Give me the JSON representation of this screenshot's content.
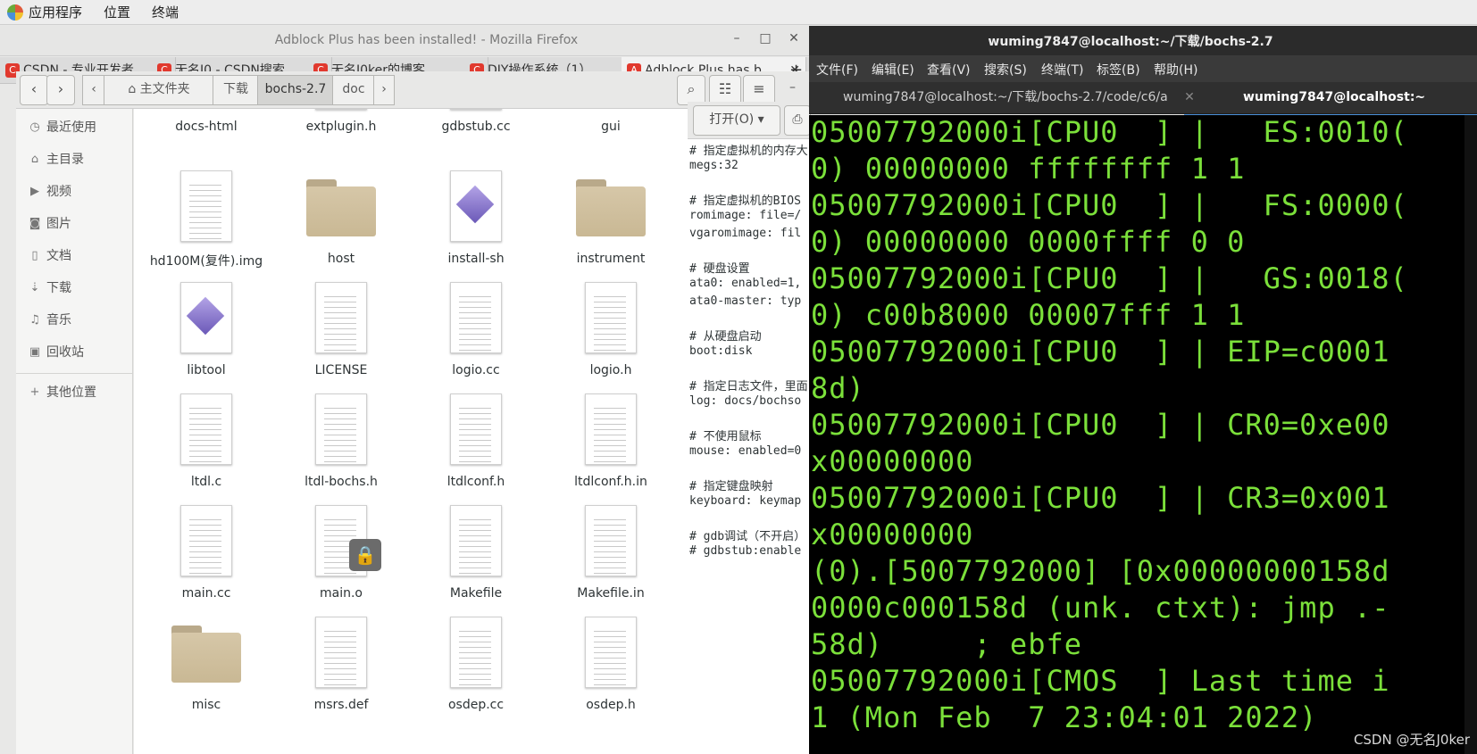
{
  "topbar": {
    "apps": "应用程序",
    "places": "位置",
    "terminal": "终端"
  },
  "firefox": {
    "title": "Adblock Plus has been installed! - Mozilla Firefox",
    "tabs": [
      {
        "label": "CSDN - 专业开发者"
      },
      {
        "label": "无名J0 - CSDN搜索"
      },
      {
        "label": "无名J0ker的博客"
      },
      {
        "label": "DIY操作系统（1）"
      },
      {
        "label": "Adblock Plus has b"
      }
    ]
  },
  "files": {
    "path": [
      "主文件夹",
      "下载",
      "bochs-2.7",
      "doc"
    ],
    "sidebar": [
      "最近使用",
      "主目录",
      "视频",
      "图片",
      "文档",
      "下载",
      "音乐",
      "回收站"
    ],
    "other_places": "其他位置",
    "items": [
      "docs-html",
      "extplugin.h",
      "gdbstub.cc",
      "gui",
      "hd100M(复件).img",
      "host",
      "install-sh",
      "instrument",
      "libtool",
      "LICENSE",
      "logio.cc",
      "logio.h",
      "ltdl.c",
      "ltdl-bochs.h",
      "ltdlconf.h",
      "ltdlconf.h.in",
      "main.cc",
      "main.o",
      "Makefile",
      "Makefile.in",
      "misc",
      "msrs.def",
      "osdep.cc",
      "osdep.h"
    ]
  },
  "gedit": {
    "open_button": "打开(O)",
    "lines": [
      "# 指定虚拟机的内存大",
      "megs:32",
      "",
      "# 指定虚拟机的BIOS",
      "romimage: file=/",
      "vgaromimage: fil",
      "",
      "# 硬盘设置",
      "ata0: enabled=1,",
      "ata0-master: typ",
      "",
      "# 从硬盘启动",
      "boot:disk",
      "",
      "# 指定日志文件，里面",
      "log: docs/bochso",
      "",
      "# 不使用鼠标",
      "mouse: enabled=0",
      "",
      "# 指定键盘映射",
      "keyboard: keymap",
      "",
      "# gdb调试（不开启）",
      "# gdbstub:enable"
    ]
  },
  "terminal": {
    "title": "wuming7847@localhost:~/下载/bochs-2.7",
    "menu": [
      "文件(F)",
      "编辑(E)",
      "查看(V)",
      "搜索(S)",
      "终端(T)",
      "标签(B)",
      "帮助(H)"
    ],
    "tabs": [
      "wuming7847@localhost:~/下载/bochs-2.7/code/c6/a",
      "wuming7847@localhost:~"
    ],
    "lines": [
      "05007792000i[CPU0  ] |   ES:0010(",
      "0) 00000000 ffffffff 1 1",
      "05007792000i[CPU0  ] |   FS:0000(",
      "0) 00000000 0000ffff 0 0",
      "05007792000i[CPU0  ] |   GS:0018(",
      "0) c00b8000 00007fff 1 1",
      "05007792000i[CPU0  ] | EIP=c0001",
      "8d)",
      "05007792000i[CPU0  ] | CR0=0xe00",
      "x00000000",
      "05007792000i[CPU0  ] | CR3=0x001",
      "x00000000",
      "(0).[5007792000] [0x00000000158d",
      "0000c000158d (unk. ctxt): jmp .-",
      "58d)     ; ebfe",
      "05007792000i[CMOS  ] Last time i",
      "1 (Mon Feb  7 23:04:01 2022)"
    ]
  },
  "watermark": "CSDN @无名J0ker"
}
